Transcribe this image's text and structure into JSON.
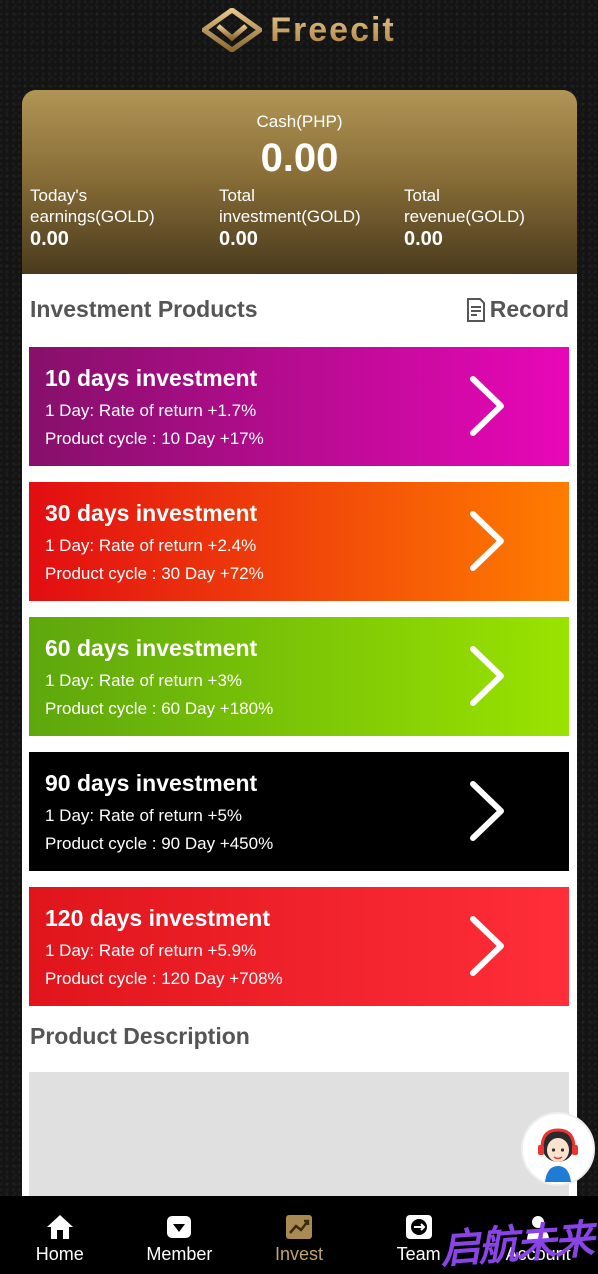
{
  "header": {
    "brand": "Freecit"
  },
  "summary": {
    "cash_label": "Cash(PHP)",
    "cash_value": "0.00",
    "stats": [
      {
        "label": "Today's earnings(GOLD)",
        "value": "0.00"
      },
      {
        "label": "Total investment(GOLD)",
        "value": "0.00"
      },
      {
        "label": "Total revenue(GOLD)",
        "value": "0.00"
      }
    ]
  },
  "products_section": {
    "title": "Investment Products",
    "record_label": "Record",
    "record_icon": "document-icon"
  },
  "products": [
    {
      "title": "10 days investment",
      "rate": "1 Day: Rate of return +1.7%",
      "cycle": "Product cycle : 10 Day +17%",
      "colors": [
        "#86106a",
        "#e807b8"
      ]
    },
    {
      "title": "30 days investment",
      "rate": "1 Day: Rate of return +2.4%",
      "cycle": "Product cycle : 30 Day +72%",
      "colors": [
        "#e20d12",
        "#ff7d00"
      ]
    },
    {
      "title": "60 days investment",
      "rate": "1 Day: Rate of return +3%",
      "cycle": "Product cycle : 60 Day +180%",
      "colors": [
        "#5ea70d",
        "#9ae300"
      ]
    },
    {
      "title": "90 days investment",
      "rate": "1 Day: Rate of return +5%",
      "cycle": "Product cycle : 90 Day +450%",
      "colors": [
        "#000000",
        "#000000"
      ]
    },
    {
      "title": "120 days investment",
      "rate": "1 Day: Rate of return +5.9%",
      "cycle": "Product cycle : 120 Day +708%",
      "colors": [
        "#e0151c",
        "#ff2e39"
      ]
    }
  ],
  "description_section": {
    "title": "Product Description"
  },
  "nav": [
    {
      "label": "Home",
      "icon": "home-icon",
      "active": false
    },
    {
      "label": "Member",
      "icon": "member-icon",
      "active": false
    },
    {
      "label": "Invest",
      "icon": "invest-icon",
      "active": true
    },
    {
      "label": "Team",
      "icon": "team-icon",
      "active": false
    },
    {
      "label": "Account",
      "icon": "account-icon",
      "active": false
    }
  ],
  "watermark": "启航未来",
  "colors": {
    "gold": "#c2a36a",
    "nav_bg": "#000000"
  }
}
